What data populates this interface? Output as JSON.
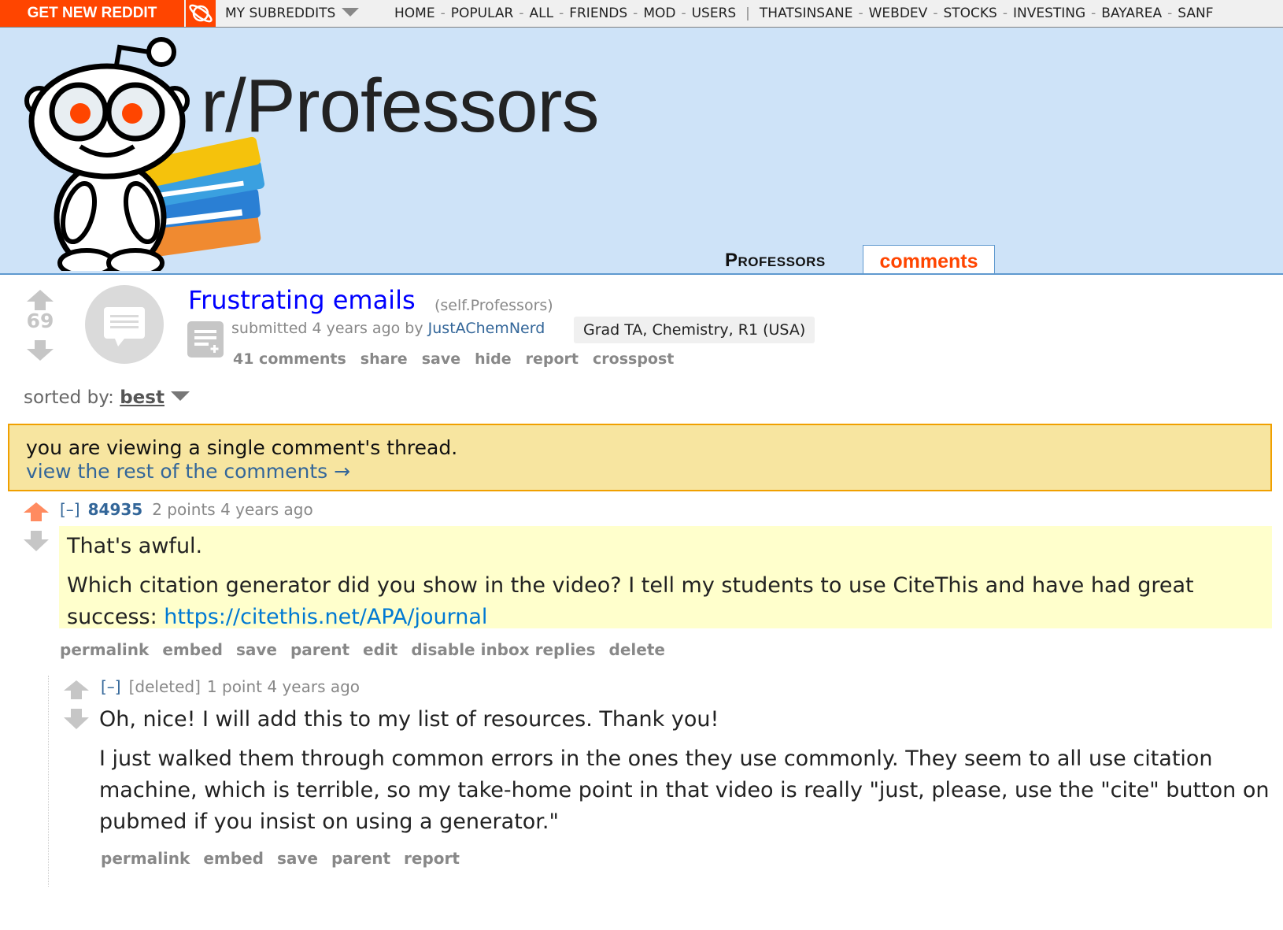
{
  "topbar": {
    "get_new_reddit": "GET NEW REDDIT",
    "my_subreddits": "MY SUBREDDITS",
    "nav_links": [
      "HOME",
      "POPULAR",
      "ALL",
      "FRIENDS",
      "MOD",
      "USERS"
    ],
    "subreddit_links": [
      "THATSINSANE",
      "WEBDEV",
      "STOCKS",
      "INVESTING",
      "BAYAREA",
      "SANF"
    ]
  },
  "header": {
    "subreddit_title": "r/Professors",
    "tab_subreddit": "Professors",
    "tab_comments": "comments"
  },
  "post": {
    "score": "69",
    "title": "Frustrating emails",
    "domain": "(self.Professors)",
    "submitted_prefix": "submitted 4 years ago by ",
    "author": "JustAChemNerd",
    "flair": "Grad TA, Chemistry, R1 (USA)",
    "buttons": [
      "41 comments",
      "share",
      "save",
      "hide",
      "report",
      "crosspost"
    ]
  },
  "sort": {
    "label": "sorted by: ",
    "value": "best"
  },
  "infobar": {
    "message": "you are viewing a single comment's thread.",
    "link": "view the rest of the comments →"
  },
  "comments": [
    {
      "toggle": "[–]",
      "author": "84935",
      "meta": "2 points 4 years ago",
      "body": [
        "That's awful.",
        "Which citation generator did you show in the video? I tell my students to use CiteThis and have had great success: "
      ],
      "link": "https://citethis.net/APA/journal",
      "buttons": [
        "permalink",
        "embed",
        "save",
        "parent",
        "edit",
        "disable inbox replies",
        "delete"
      ]
    },
    {
      "toggle": "[–]",
      "author": "[deleted]",
      "meta": "1 point 4 years ago",
      "body": [
        "Oh, nice! I will add this to my list of resources. Thank you!",
        "I just walked them through common errors in the ones they use commonly. They seem to all use citation machine, which is terrible, so my take-home point in that video is really \"just, please, use the \"cite\" button on pubmed if you insist on using a generator.\""
      ],
      "buttons": [
        "permalink",
        "embed",
        "save",
        "parent",
        "report"
      ]
    }
  ],
  "colors": {
    "accent": "#ff4500",
    "header_bg": "#cee3f8",
    "link": "#0000ff",
    "infobar_bg": "#f7e5a0",
    "highlight_bg": "#ffffcc"
  }
}
